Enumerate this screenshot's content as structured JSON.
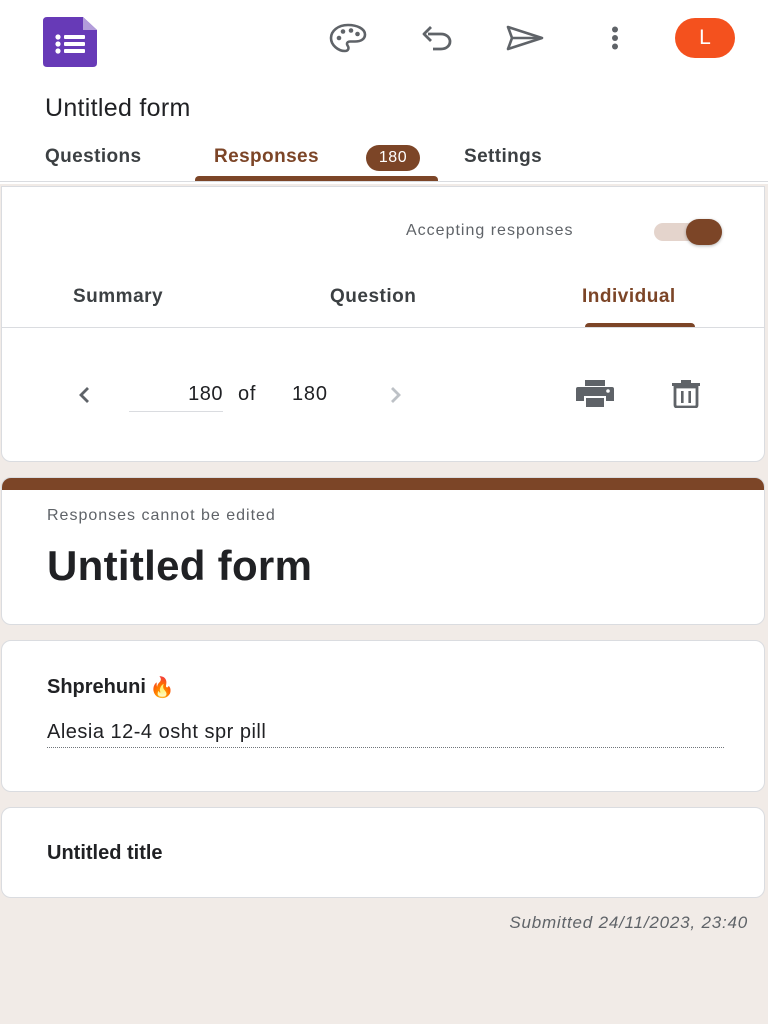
{
  "header": {
    "form_title": "Untitled form",
    "avatar_letter": "L",
    "tabs": [
      {
        "label": "Questions"
      },
      {
        "label": "Responses",
        "badge": "180"
      },
      {
        "label": "Settings"
      }
    ]
  },
  "responses_panel": {
    "accepting_label": "Accepting responses",
    "accepting": true,
    "sub_tabs": [
      {
        "label": "Summary"
      },
      {
        "label": "Question"
      },
      {
        "label": "Individual"
      }
    ],
    "pager": {
      "current": "180",
      "of_label": "of",
      "total": "180"
    }
  },
  "response": {
    "notice": "Responses cannot be edited",
    "form_title": "Untitled form",
    "questions": [
      {
        "title": "Shprehuni",
        "emoji": "🔥",
        "answer": "Alesia 12-4 osht spr pill"
      },
      {
        "title": "Untitled title"
      }
    ],
    "submitted": "Submitted 24/11/2023, 23:40"
  },
  "colors": {
    "accent": "#7c4527",
    "avatar": "#f4511e",
    "logo": "#673ab7",
    "background": "#f1ebe7"
  },
  "icons": {
    "app_logo": "google-forms-icon",
    "palette": "palette-icon",
    "undo": "undo-icon",
    "send": "send-icon",
    "more": "more-vert-icon",
    "prev": "chevron-left-icon",
    "next": "chevron-right-icon",
    "print": "print-icon",
    "delete": "trash-icon"
  }
}
